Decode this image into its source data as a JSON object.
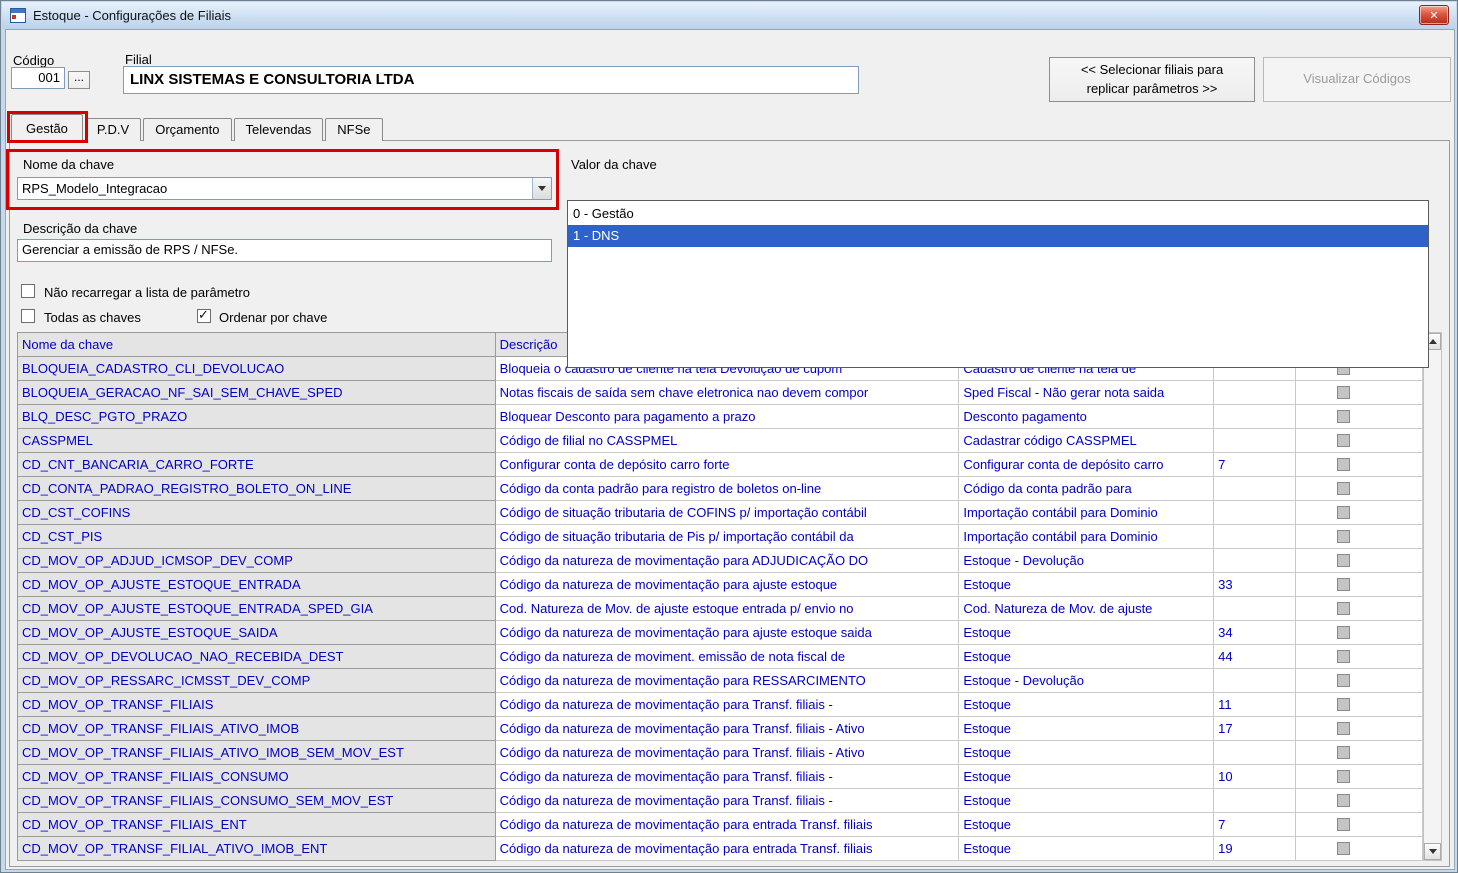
{
  "window": {
    "title": "Estoque - Configurações de Filiais"
  },
  "header": {
    "codigo_label": "Código",
    "codigo_value": "001",
    "browse_label": "...",
    "filial_label": "Filial",
    "filial_value": "LINX SISTEMAS E CONSULTORIA LTDA",
    "replicate_line1": "<< Selecionar filiais para",
    "replicate_line2": "replicar parâmetros >>",
    "visualizar_label": "Visualizar Códigos"
  },
  "tabs": [
    {
      "label": "Gestão",
      "active": true,
      "annotated": true
    },
    {
      "label": "P.D.V",
      "active": false
    },
    {
      "label": "Orçamento",
      "active": false
    },
    {
      "label": "Televendas",
      "active": false
    },
    {
      "label": "NFSe",
      "active": false
    }
  ],
  "params": {
    "nome_label": "Nome da chave",
    "nome_value": "RPS_Modelo_Integracao",
    "valor_label": "Valor da chave",
    "valor_value": "1 - DNS",
    "valor_options": [
      "0 - Gestão",
      "1 - DNS"
    ],
    "valor_selected_index": 1,
    "descricao_label": "Descrição da chave",
    "descricao_value": "Gerenciar a emissão de RPS / NFSe.",
    "chk_nao_recarregar": "Não recarregar a lista de parâmetro",
    "chk_todas": "Todas as chaves",
    "chk_ordenar": "Ordenar por chave"
  },
  "grid": {
    "headers": [
      "Nome da chave",
      "Descrição"
    ],
    "rows": [
      {
        "name": "BLOQUEIA_CADASTRO_CLI_DEVOLUCAO",
        "desc": "Bloqueia o cadastro de cliente na tela Devolução de cupom",
        "info": "Cadastro de cliente na tela de",
        "value": ""
      },
      {
        "name": "BLOQUEIA_GERACAO_NF_SAI_SEM_CHAVE_SPED",
        "desc": "Notas fiscais de saída sem chave eletronica nao devem compor",
        "info": "Sped Fiscal - Não gerar nota saida",
        "value": ""
      },
      {
        "name": "BLQ_DESC_PGTO_PRAZO",
        "desc": "Bloquear Desconto para pagamento a prazo",
        "info": "Desconto pagamento",
        "value": ""
      },
      {
        "name": "CASSPMEL",
        "desc": "Código de filial no CASSPMEL",
        "info": "Cadastrar código CASSPMEL",
        "value": ""
      },
      {
        "name": "CD_CNT_BANCARIA_CARRO_FORTE",
        "desc": "Configurar conta de depósito carro forte",
        "info": "Configurar conta de depósito carro",
        "value": "7"
      },
      {
        "name": "CD_CONTA_PADRAO_REGISTRO_BOLETO_ON_LINE",
        "desc": "Código da conta padrão para registro de boletos on-line",
        "info": "Código da conta padrão para",
        "value": ""
      },
      {
        "name": "CD_CST_COFINS",
        "desc": "Código de situação tributaria de COFINS  p/ importação contábil",
        "info": "Importação contábil para Dominio",
        "value": ""
      },
      {
        "name": "CD_CST_PIS",
        "desc": "Código de situação tributaria de Pis  p/ importação contábil da",
        "info": "Importação contábil para Dominio",
        "value": ""
      },
      {
        "name": "CD_MOV_OP_ADJUD_ICMSOP_DEV_COMP",
        "desc": "Código da natureza de movimentação para ADJUDICAÇÃO DO",
        "info": "Estoque - Devolução",
        "value": ""
      },
      {
        "name": "CD_MOV_OP_AJUSTE_ESTOQUE_ENTRADA",
        "desc": "Código da natureza de movimentação para ajuste estoque",
        "info": "Estoque",
        "value": "33"
      },
      {
        "name": "CD_MOV_OP_AJUSTE_ESTOQUE_ENTRADA_SPED_GIA",
        "desc": "Cod. Natureza de Mov. de ajuste estoque entrada p/ envio no",
        "info": "Cod. Natureza de Mov. de ajuste",
        "value": ""
      },
      {
        "name": "CD_MOV_OP_AJUSTE_ESTOQUE_SAIDA",
        "desc": "Código da natureza de movimentação para ajuste estoque saida",
        "info": "Estoque",
        "value": "34"
      },
      {
        "name": "CD_MOV_OP_DEVOLUCAO_NAO_RECEBIDA_DEST",
        "desc": "Código da natureza de moviment. emissão de nota fiscal de",
        "info": "Estoque",
        "value": "44"
      },
      {
        "name": "CD_MOV_OP_RESSARC_ICMSST_DEV_COMP",
        "desc": "Código da natureza de movimentação para RESSARCIMENTO",
        "info": "Estoque - Devolução",
        "value": ""
      },
      {
        "name": "CD_MOV_OP_TRANSF_FILIAIS",
        "desc": "Código da natureza de movimentação para Transf. filiais -",
        "info": "Estoque",
        "value": "11"
      },
      {
        "name": "CD_MOV_OP_TRANSF_FILIAIS_ATIVO_IMOB",
        "desc": "Código da natureza de movimentação para Transf. filiais - Ativo",
        "info": "Estoque",
        "value": "17"
      },
      {
        "name": "CD_MOV_OP_TRANSF_FILIAIS_ATIVO_IMOB_SEM_MOV_EST",
        "desc": "Código da natureza de movimentação para Transf. filiais - Ativo",
        "info": "Estoque",
        "value": ""
      },
      {
        "name": "CD_MOV_OP_TRANSF_FILIAIS_CONSUMO",
        "desc": "Código da natureza de movimentação para Transf. filiais -",
        "info": "Estoque",
        "value": "10"
      },
      {
        "name": "CD_MOV_OP_TRANSF_FILIAIS_CONSUMO_SEM_MOV_EST",
        "desc": "Código da natureza de movimentação para Transf. filiais -",
        "info": "Estoque",
        "value": ""
      },
      {
        "name": "CD_MOV_OP_TRANSF_FILIAIS_ENT",
        "desc": "Código da natureza de movimentação para entrada Transf. filiais",
        "info": "Estoque",
        "value": "7"
      },
      {
        "name": "CD_MOV_OP_TRANSF_FILIAL_ATIVO_IMOB_ENT",
        "desc": "Código da natureza de movimentação para entrada Transf. filiais",
        "info": "Estoque",
        "value": "19"
      }
    ]
  },
  "colors": {
    "annotation_red": "#D60000",
    "selection_blue": "#2E62C8",
    "grid_text_blue": "#0000C4",
    "titlebar_blue": "#CBDEF2"
  }
}
